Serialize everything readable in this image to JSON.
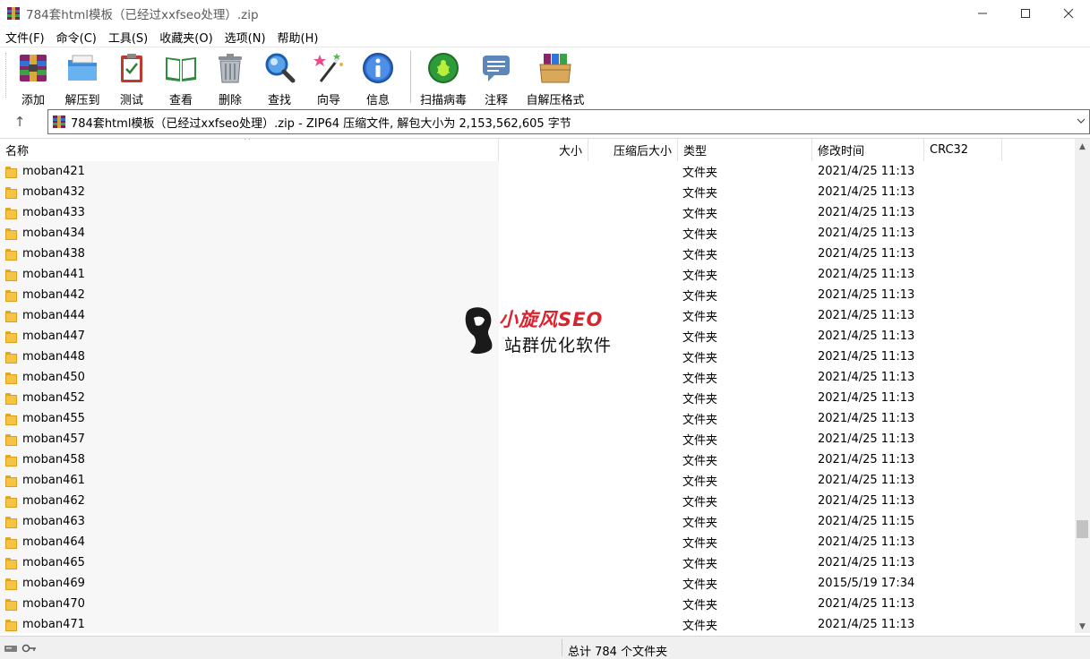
{
  "window": {
    "title": "784套html模板（已经过xxfseo处理）.zip",
    "controls": {
      "minimize": "─",
      "maximize": "☐",
      "close": "✕"
    }
  },
  "menu": [
    "文件(F)",
    "命令(C)",
    "工具(S)",
    "收藏夹(O)",
    "选项(N)",
    "帮助(H)"
  ],
  "toolbar": {
    "tools": [
      {
        "label": "添加",
        "icon": "add-archive-icon"
      },
      {
        "label": "解压到",
        "icon": "extract-folder-icon"
      },
      {
        "label": "测试",
        "icon": "test-clipboard-icon"
      },
      {
        "label": "查看",
        "icon": "view-book-icon"
      },
      {
        "label": "删除",
        "icon": "delete-trash-icon"
      },
      {
        "label": "查找",
        "icon": "find-magnifier-icon"
      },
      {
        "label": "向导",
        "icon": "wizard-wand-icon"
      },
      {
        "label": "信息",
        "icon": "info-icon"
      },
      {
        "label": "扫描病毒",
        "icon": "virus-scan-icon"
      },
      {
        "label": "注释",
        "icon": "comment-icon"
      },
      {
        "label": "自解压格式",
        "icon": "sfx-box-icon"
      }
    ]
  },
  "address": {
    "up": "↑",
    "text": "784套html模板（已经过xxfseo处理）.zip - ZIP64 压缩文件, 解包大小为 2,153,562,605 字节",
    "dropdown": "⌵"
  },
  "columns": {
    "name": "名称",
    "size": "大小",
    "packed": "压缩后大小",
    "type": "类型",
    "modified": "修改时间",
    "crc": "CRC32",
    "sort_arrow": "^"
  },
  "files": [
    {
      "name": "moban421",
      "type": "文件夹",
      "modified": "2021/4/25 11:13"
    },
    {
      "name": "moban432",
      "type": "文件夹",
      "modified": "2021/4/25 11:13"
    },
    {
      "name": "moban433",
      "type": "文件夹",
      "modified": "2021/4/25 11:13"
    },
    {
      "name": "moban434",
      "type": "文件夹",
      "modified": "2021/4/25 11:13"
    },
    {
      "name": "moban438",
      "type": "文件夹",
      "modified": "2021/4/25 11:13"
    },
    {
      "name": "moban441",
      "type": "文件夹",
      "modified": "2021/4/25 11:13"
    },
    {
      "name": "moban442",
      "type": "文件夹",
      "modified": "2021/4/25 11:13"
    },
    {
      "name": "moban444",
      "type": "文件夹",
      "modified": "2021/4/25 11:13"
    },
    {
      "name": "moban447",
      "type": "文件夹",
      "modified": "2021/4/25 11:13"
    },
    {
      "name": "moban448",
      "type": "文件夹",
      "modified": "2021/4/25 11:13"
    },
    {
      "name": "moban450",
      "type": "文件夹",
      "modified": "2021/4/25 11:13"
    },
    {
      "name": "moban452",
      "type": "文件夹",
      "modified": "2021/4/25 11:13"
    },
    {
      "name": "moban455",
      "type": "文件夹",
      "modified": "2021/4/25 11:13"
    },
    {
      "name": "moban457",
      "type": "文件夹",
      "modified": "2021/4/25 11:13"
    },
    {
      "name": "moban458",
      "type": "文件夹",
      "modified": "2021/4/25 11:13"
    },
    {
      "name": "moban461",
      "type": "文件夹",
      "modified": "2021/4/25 11:13"
    },
    {
      "name": "moban462",
      "type": "文件夹",
      "modified": "2021/4/25 11:13"
    },
    {
      "name": "moban463",
      "type": "文件夹",
      "modified": "2021/4/25 11:15"
    },
    {
      "name": "moban464",
      "type": "文件夹",
      "modified": "2021/4/25 11:13"
    },
    {
      "name": "moban465",
      "type": "文件夹",
      "modified": "2021/4/25 11:13"
    },
    {
      "name": "moban469",
      "type": "文件夹",
      "modified": "2015/5/19 17:34"
    },
    {
      "name": "moban470",
      "type": "文件夹",
      "modified": "2021/4/25 11:13"
    },
    {
      "name": "moban471",
      "type": "文件夹",
      "modified": "2021/4/25 11:13"
    }
  ],
  "scrollbar": {
    "up": "▲",
    "down": "▼",
    "position": 0.82
  },
  "watermark": {
    "title": "小旋风SEO",
    "subtitle": "站群优化软件"
  },
  "status": {
    "text": "总计 784 个文件夹"
  },
  "colors": {
    "accent": "#1e7bd6",
    "folder": "#f5c445",
    "watermark_red": "#d9232e"
  }
}
